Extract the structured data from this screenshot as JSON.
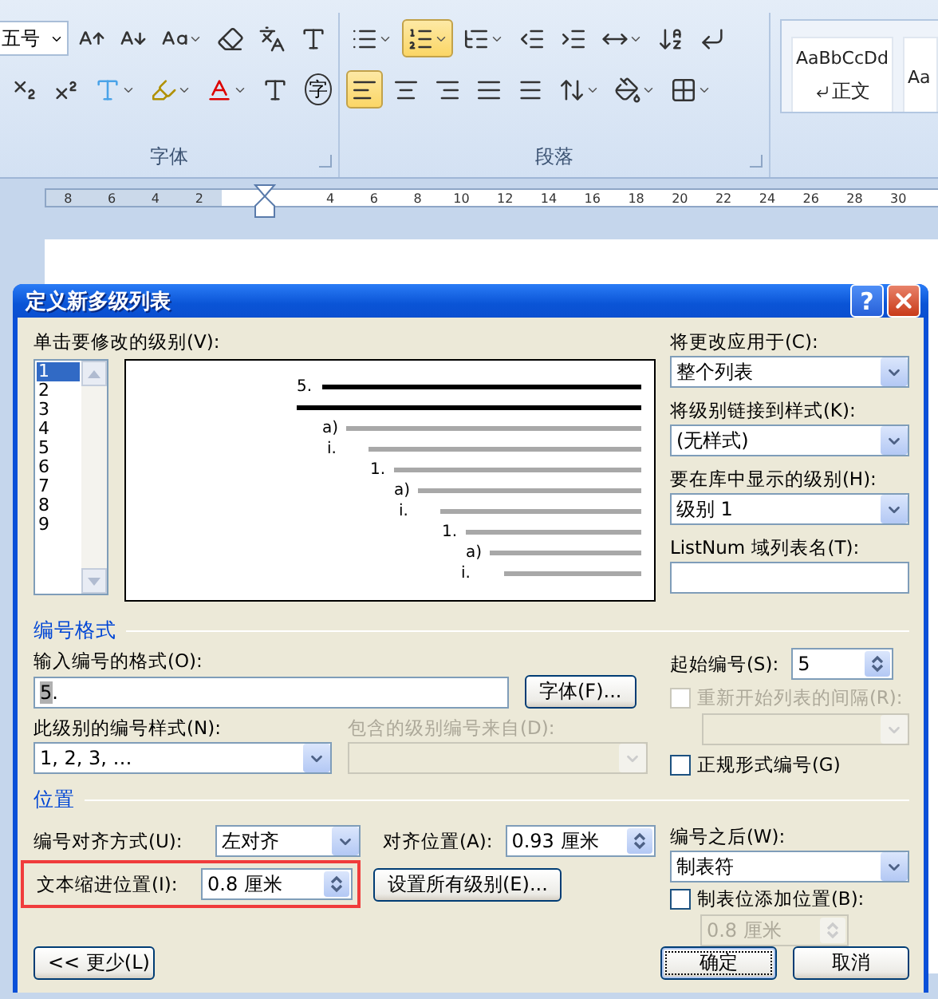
{
  "ribbon": {
    "font_size": "五号",
    "font_row1": [
      {
        "kind": "grow",
        "dropdown": false
      },
      {
        "kind": "shrink",
        "dropdown": false
      },
      {
        "kind": "case",
        "dropdown": true
      },
      {
        "kind": "clear",
        "dropdown": false
      },
      {
        "kind": "phonetic",
        "dropdown": false
      },
      {
        "kind": "border-char",
        "dropdown": false
      }
    ],
    "font_row2": [
      {
        "kind": "subscript",
        "dropdown": false
      },
      {
        "kind": "superscript",
        "dropdown": false
      },
      {
        "kind": "text-effect",
        "dropdown": true
      },
      {
        "kind": "highlight",
        "dropdown": true
      },
      {
        "kind": "font-color",
        "dropdown": true
      },
      {
        "kind": "shading-char",
        "dropdown": false
      }
    ],
    "enclosed_char": "字",
    "font_group": "字体",
    "para_row1": [
      {
        "kind": "bullets",
        "dropdown": true,
        "selected": false
      },
      {
        "kind": "numbering",
        "dropdown": true,
        "selected": true
      },
      {
        "kind": "multilevel",
        "dropdown": true,
        "selected": false
      },
      {
        "kind": "outdent",
        "dropdown": false,
        "selected": false
      },
      {
        "kind": "indent",
        "dropdown": false,
        "selected": false
      },
      {
        "kind": "layout",
        "dropdown": true,
        "selected": false
      },
      {
        "kind": "sort",
        "dropdown": false,
        "selected": false
      },
      {
        "kind": "marks",
        "dropdown": false,
        "selected": false
      }
    ],
    "para_row2": [
      {
        "kind": "align-left",
        "dropdown": false,
        "selected": true
      },
      {
        "kind": "align-center",
        "dropdown": false,
        "selected": false
      },
      {
        "kind": "align-right",
        "dropdown": false,
        "selected": false
      },
      {
        "kind": "justify",
        "dropdown": false,
        "selected": false
      },
      {
        "kind": "distribute",
        "dropdown": false,
        "selected": false
      },
      {
        "kind": "line-spacing",
        "dropdown": true,
        "selected": false
      },
      {
        "kind": "shading",
        "dropdown": true,
        "selected": false
      },
      {
        "kind": "borders",
        "dropdown": true,
        "selected": false
      }
    ],
    "paragraph_group": "段落",
    "styles": [
      {
        "sample": "AaBbCcDd",
        "name": "正文"
      },
      {
        "sample": "Aa"
      }
    ]
  },
  "ruler": {
    "left_labels": [
      "8",
      "6",
      "4",
      "2"
    ],
    "right_labels": [
      "4",
      "6",
      "8",
      "10",
      "12",
      "14",
      "16",
      "18",
      "20",
      "22",
      "24",
      "26",
      "28",
      "30"
    ]
  },
  "dialog": {
    "title": "定义新多级列表",
    "help": "?",
    "levels_label": "单击要修改的级别(V):",
    "levels": [
      {
        "label": "1",
        "selected": true
      },
      {
        "label": "2",
        "selected": false
      },
      {
        "label": "3",
        "selected": false
      },
      {
        "label": "4",
        "selected": false
      },
      {
        "label": "5",
        "selected": false
      },
      {
        "label": "6",
        "selected": false
      },
      {
        "label": "7",
        "selected": false
      },
      {
        "label": "8",
        "selected": false
      },
      {
        "label": "9",
        "selected": false
      }
    ],
    "preview": [
      {
        "number": "5.",
        "current": true
      },
      {
        "current": true
      },
      {
        "number": "a)",
        "current": false
      },
      {
        "number": "i.",
        "current": false
      },
      {
        "number": "1.",
        "current": false
      },
      {
        "number": "a)",
        "current": false
      },
      {
        "number": "i.",
        "current": false
      },
      {
        "number": "1.",
        "current": false
      },
      {
        "number": "a)",
        "current": false
      },
      {
        "number": "i.",
        "current": false
      }
    ],
    "apply_label": "将更改应用于(C):",
    "apply_value": "整个列表",
    "link_label": "将级别链接到样式(K):",
    "link_value": "(无样式)",
    "gallery_label": "要在库中显示的级别(H):",
    "gallery_value": "级别 1",
    "listnum_label": "ListNum 域列表名(T):",
    "format_section": "编号格式",
    "format_label": "输入编号的格式(O):",
    "format_number": "5",
    "format_rest": ".",
    "font_button": "字体(F)...",
    "style_label": "此级别的编号样式(N):",
    "style_value": "1, 2, 3, …",
    "include_label": "包含的级别编号来自(D):",
    "start_label": "起始编号(S):",
    "start_value": "5",
    "restart_label": "重新开始列表的间隔(R):",
    "restart_checked": false,
    "legal_label": "正规形式编号(G)",
    "legal_checked": false,
    "position_section": "位置",
    "align_label": "编号对齐方式(U):",
    "align_value": "左对齐",
    "at_label": "对齐位置(A):",
    "at_value": "0.93 厘米",
    "indent_label": "文本缩进位置(I):",
    "indent_value": "0.8 厘米",
    "set_all_button": "设置所有级别(E)...",
    "follow_label": "编号之后(W):",
    "follow_value": "制表符",
    "tabstop_label": "制表位添加位置(B):",
    "tabstop_checked": false,
    "tabstop_value": "0.8 厘米",
    "less_button": "<< 更少(L)",
    "ok_button": "确定",
    "cancel_button": "取消"
  }
}
